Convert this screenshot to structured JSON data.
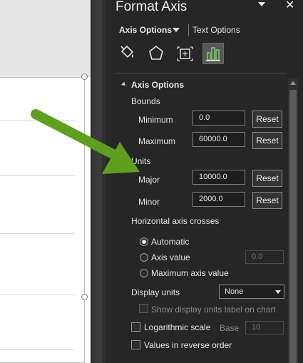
{
  "panel": {
    "title": "Format Axis",
    "tabs": {
      "axis_options": "Axis Options",
      "text_options": "Text Options"
    }
  },
  "icons": [
    "fill-line-icon",
    "effects-icon",
    "size-properties-icon",
    "axis-options-icon"
  ],
  "axis_options": {
    "section_title": "Axis Options",
    "bounds": {
      "heading": "Bounds",
      "minimum": {
        "label": "Minimum",
        "value": "0.0",
        "reset": "Reset"
      },
      "maximum": {
        "label": "Maximum",
        "value": "60000.0",
        "reset": "Reset"
      }
    },
    "units": {
      "heading": "Units",
      "major": {
        "label": "Major",
        "value": "10000.0",
        "reset": "Reset"
      },
      "minor": {
        "label": "Minor",
        "value": "2000.0",
        "reset": "Reset"
      }
    },
    "crosses": {
      "heading": "Horizontal axis crosses",
      "automatic": "Automatic",
      "axis_value": "Axis value",
      "axis_value_input": "0.0",
      "maximum": "Maximum axis value",
      "selected": "automatic"
    },
    "display_units": {
      "label": "Display units",
      "value": "None",
      "show_label": "Show display units label on chart"
    },
    "log_scale": {
      "label": "Logarithmic scale",
      "base_label": "Base",
      "base_value": "10",
      "checked": false
    },
    "reverse": {
      "label": "Values in reverse order",
      "checked": false
    }
  },
  "colors": {
    "panel_bg": "#262626",
    "arrow": "#5ea01e"
  }
}
